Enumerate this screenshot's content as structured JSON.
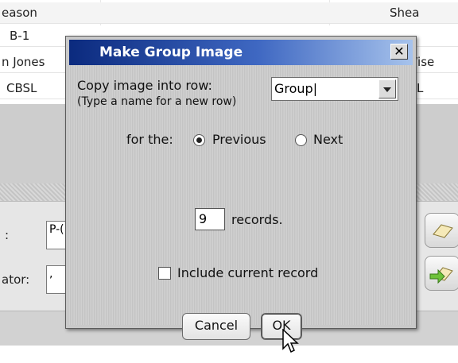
{
  "background": {
    "rows": [
      {
        "col1": "eason",
        "col2": "",
        "col3": "Shea"
      },
      {
        "col1": "B-1",
        "col2": "",
        "col3": ""
      },
      {
        "col1": "n Jones",
        "col2": "",
        "col3": "/ise"
      },
      {
        "col1": "CBSL",
        "col2": "",
        "col3": "L"
      }
    ],
    "panel_label_1": ":",
    "panel_field_1": "P-(",
    "panel_label_2": "ator:",
    "panel_field_2": ","
  },
  "dialog": {
    "title": "Make Group Image",
    "close_glyph": "✕",
    "copy_label": "Copy image into row:",
    "copy_hint": "(Type a name for a new row)",
    "row_name": "Group|",
    "for_label": "for the:",
    "option_previous": "Previous",
    "option_next": "Next",
    "selected_option": "Previous",
    "records_count": "9",
    "records_label": "records.",
    "include_label": "Include current record",
    "include_checked": false,
    "cancel_label": "Cancel",
    "ok_label": "OK"
  },
  "colors": {
    "titlebar_start": "#0b2a7e",
    "titlebar_end": "#a7c3ec",
    "dialog_bg": "#c9c9c9"
  },
  "icons": [
    "close-icon",
    "dropdown-arrow-icon",
    "mouse-pointer-icon",
    "book-icon",
    "arrow-book-icon"
  ]
}
